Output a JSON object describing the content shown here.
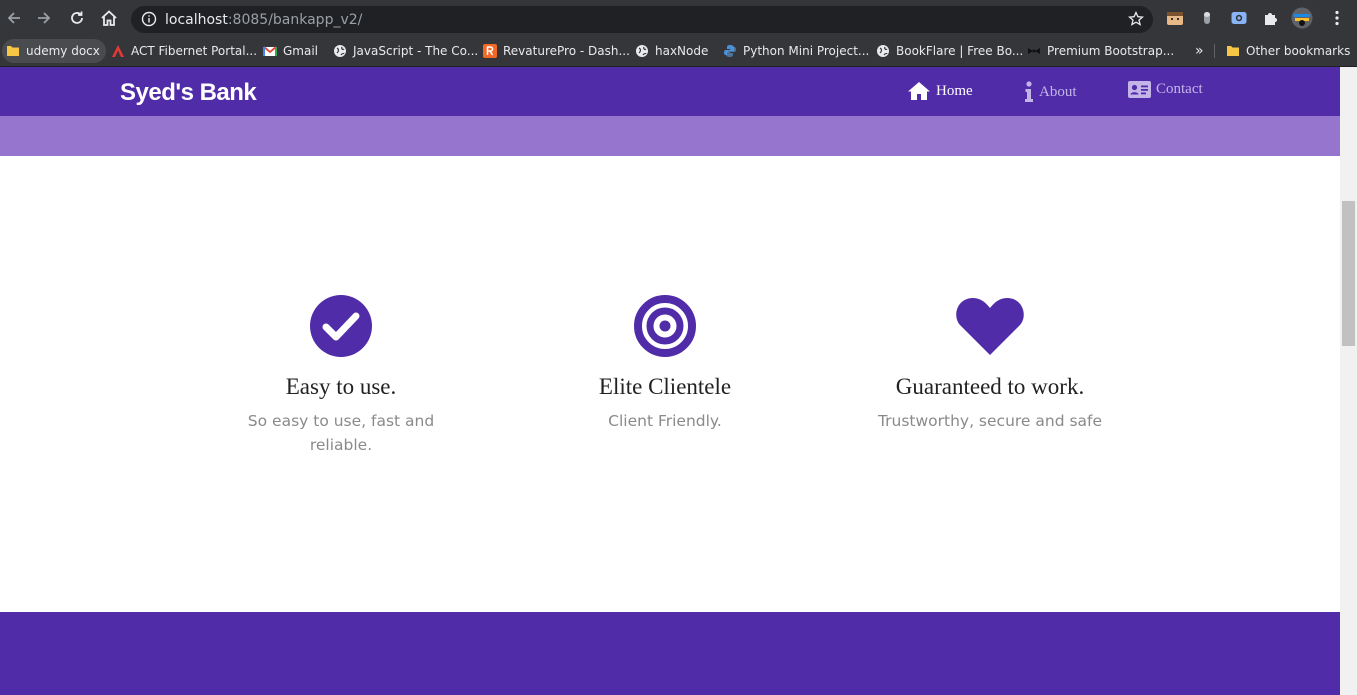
{
  "browser": {
    "url_host": "localhost",
    "url_path": ":8085/bankapp_v2/",
    "bookmarks": [
      {
        "label": "udemy docx",
        "icon": "folder-icon"
      },
      {
        "label": "ACT Fibernet Portal...",
        "icon": "act-logo-icon"
      },
      {
        "label": "Gmail",
        "icon": "gmail-icon"
      },
      {
        "label": "JavaScript - The Co...",
        "icon": "globe-icon"
      },
      {
        "label": "RevaturePro - Dash...",
        "icon": "revature-icon"
      },
      {
        "label": "haxNode",
        "icon": "globe-icon"
      },
      {
        "label": "Python Mini Project...",
        "icon": "python-icon"
      },
      {
        "label": "BookFlare | Free Bo...",
        "icon": "globe-icon"
      },
      {
        "label": "Premium Bootstrap...",
        "icon": "bow-icon"
      }
    ],
    "overflow_label": "»",
    "other_bookmarks": "Other bookmarks"
  },
  "site": {
    "brand": "Syed's Bank",
    "nav": [
      {
        "label": "Home",
        "icon": "home-icon",
        "active": true
      },
      {
        "label": "About",
        "icon": "info-icon",
        "active": false
      },
      {
        "label": "Contact",
        "icon": "id-card-icon",
        "active": false
      }
    ],
    "features": [
      {
        "icon": "check-circle-icon",
        "title": "Easy to use.",
        "desc": "So easy to use, fast and reliable."
      },
      {
        "icon": "bullseye-icon",
        "title": "Elite Clientele",
        "desc": "Client Friendly."
      },
      {
        "icon": "heart-icon",
        "title": "Guaranteed to work.",
        "desc": "Trustworthy, secure and safe"
      }
    ]
  },
  "colors": {
    "primary": "#502ca8",
    "band": "#9575cd",
    "muted_text": "#8a8a8a"
  }
}
